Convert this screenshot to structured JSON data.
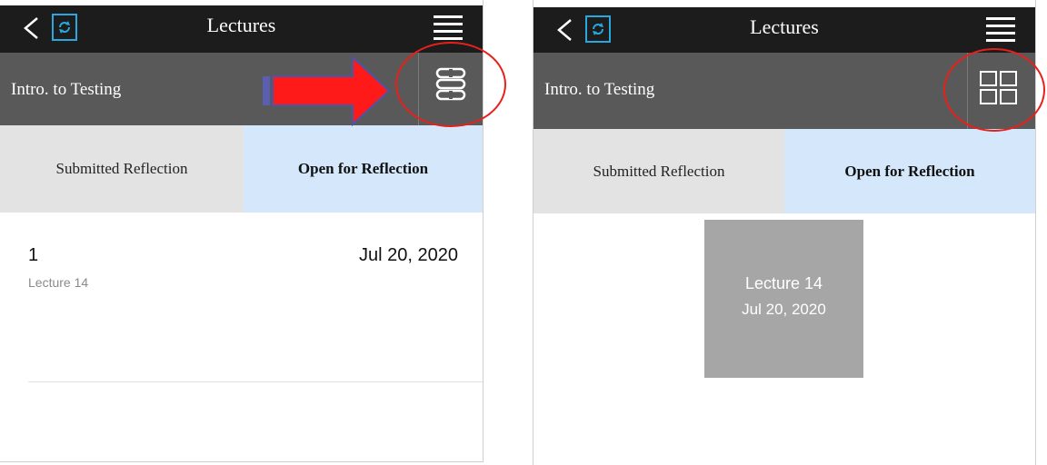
{
  "left_screen": {
    "header": {
      "title": "Lectures",
      "back_icon": "chevron-left-icon",
      "logo_icon": "sync-logo-icon",
      "menu_icon": "hamburger-menu-icon"
    },
    "course": {
      "title": "Intro. to Testing",
      "toggle_icon": "list-view-icon"
    },
    "tabs": [
      {
        "label": "Submitted Reflection",
        "selected": false
      },
      {
        "label": "Open for Reflection",
        "selected": true
      }
    ],
    "lecture": {
      "number": "1",
      "name": "Lecture 14",
      "date": "Jul 20, 2020"
    }
  },
  "right_screen": {
    "header": {
      "title": "Lectures",
      "back_icon": "chevron-left-icon",
      "logo_icon": "sync-logo-icon",
      "menu_icon": "hamburger-menu-icon"
    },
    "course": {
      "title": "Intro. to Testing",
      "toggle_icon": "grid-view-icon"
    },
    "tabs": [
      {
        "label": "Submitted Reflection",
        "selected": false
      },
      {
        "label": "Open for Reflection",
        "selected": true
      }
    ],
    "lecture_card": {
      "name": "Lecture 14",
      "date": "Jul 20, 2020"
    }
  },
  "annotations": {
    "arrow_color": "#ff1a1a",
    "circle_color": "#e8201c"
  },
  "colors": {
    "topbar": "#1c1c1c",
    "subbar": "#595959",
    "tab_active": "#d4e7fb",
    "tab_inactive": "#e3e3e3",
    "logo_accent": "#29a8e0"
  }
}
